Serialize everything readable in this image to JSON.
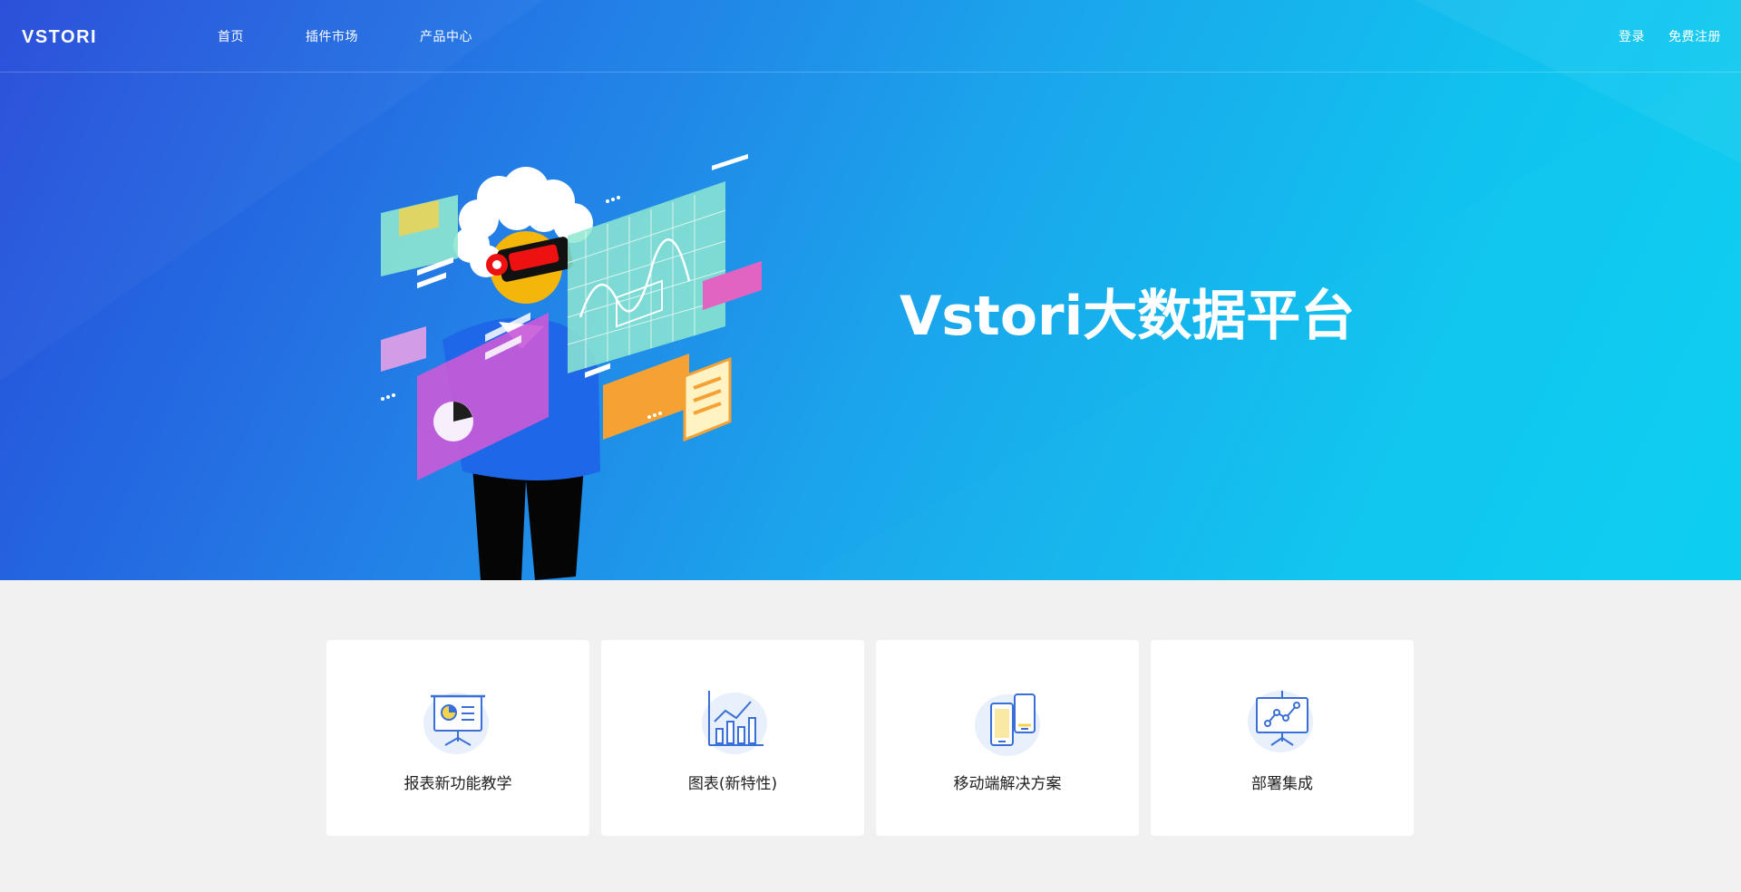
{
  "nav": {
    "logo_text": "VSTORI",
    "links": [
      "首页",
      "插件市场",
      "产品中心"
    ],
    "login": "登录",
    "register": "免费注册"
  },
  "hero": {
    "title": "Vstori大数据平台",
    "illustration": "person-with-vr-headset-and-holographic-panels"
  },
  "cards": [
    {
      "label": "报表新功能教学",
      "icon": "presentation-board-icon"
    },
    {
      "label": "图表(新特性)",
      "icon": "bar-chart-icon"
    },
    {
      "label": "移动端解决方案",
      "icon": "mobile-devices-icon"
    },
    {
      "label": "部署集成",
      "icon": "line-chart-board-icon"
    }
  ],
  "colors": {
    "hero_gradient_start": "#1f46d8",
    "hero_gradient_end": "#05cdf0",
    "page_bg": "#f1f1f1",
    "icon_accent": "#3b6fd8"
  }
}
